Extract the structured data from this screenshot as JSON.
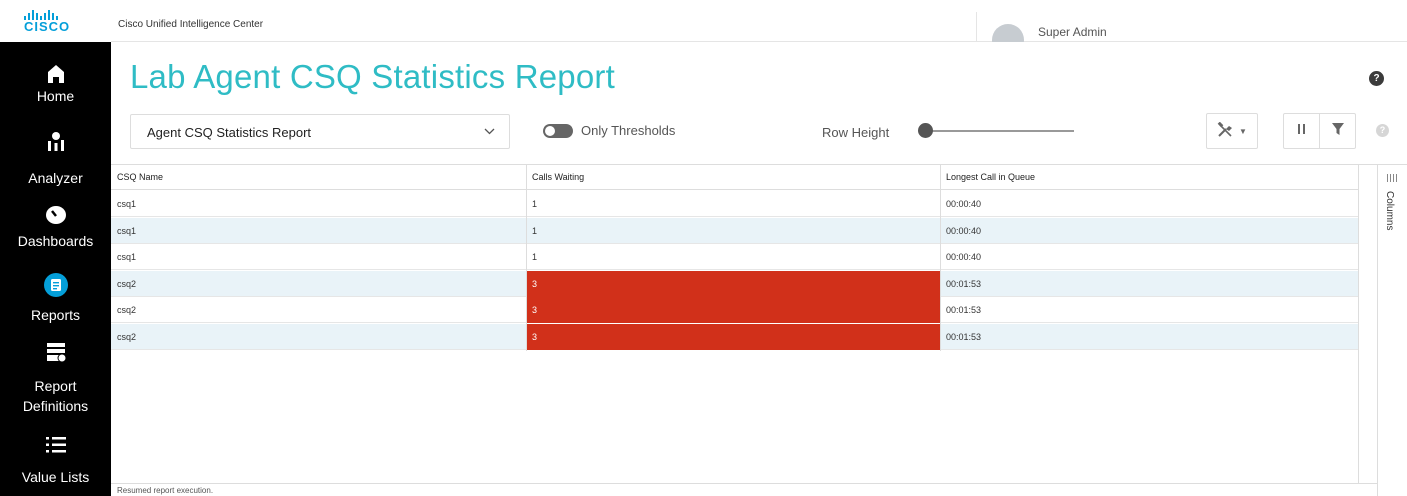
{
  "app": {
    "title": "Cisco Unified Intelligence Center",
    "logo_text": "CISCO"
  },
  "user": {
    "name": "Super Admin"
  },
  "sidebar": {
    "items": [
      {
        "label": "Home",
        "icon": "home-icon"
      },
      {
        "label": "Analyzer",
        "icon": "analyzer-icon"
      },
      {
        "label": "Dashboards",
        "icon": "dashboard-icon"
      },
      {
        "label": "Reports",
        "icon": "reports-icon",
        "active": true
      },
      {
        "label": "Report",
        "label2": "Definitions",
        "icon": "report-definitions-icon"
      },
      {
        "label": "Value Lists",
        "icon": "list-icon"
      }
    ]
  },
  "page": {
    "title": "Lab Agent CSQ Statistics Report",
    "help": "?"
  },
  "toolbar": {
    "report_select": "Agent CSQ Statistics Report",
    "only_thresholds_label": "Only Thresholds",
    "only_thresholds_on": false,
    "row_height_label": "Row Height",
    "row_height_level": 0,
    "help": "?"
  },
  "grid": {
    "columns": [
      "CSQ Name",
      "Calls Waiting",
      "Longest Call in Queue"
    ],
    "rows": [
      {
        "csq": "csq1",
        "waiting": "1",
        "longest": "00:00:40",
        "threshold": false
      },
      {
        "csq": "csq1",
        "waiting": "1",
        "longest": "00:00:40",
        "threshold": false
      },
      {
        "csq": "csq1",
        "waiting": "1",
        "longest": "00:00:40",
        "threshold": false
      },
      {
        "csq": "csq2",
        "waiting": "3",
        "longest": "00:01:53",
        "threshold": true
      },
      {
        "csq": "csq2",
        "waiting": "3",
        "longest": "00:01:53",
        "threshold": true
      },
      {
        "csq": "csq2",
        "waiting": "3",
        "longest": "00:01:53",
        "threshold": true
      }
    ],
    "columns_tab_label": "Columns",
    "threshold_color": "#d1301a",
    "alt_row_color": "#e9f3f8"
  },
  "status": {
    "message": "Resumed report execution."
  },
  "colors": {
    "accent_title": "#2fbcc5",
    "cisco_blue": "#049fd9",
    "sidebar_bg": "#000000"
  }
}
